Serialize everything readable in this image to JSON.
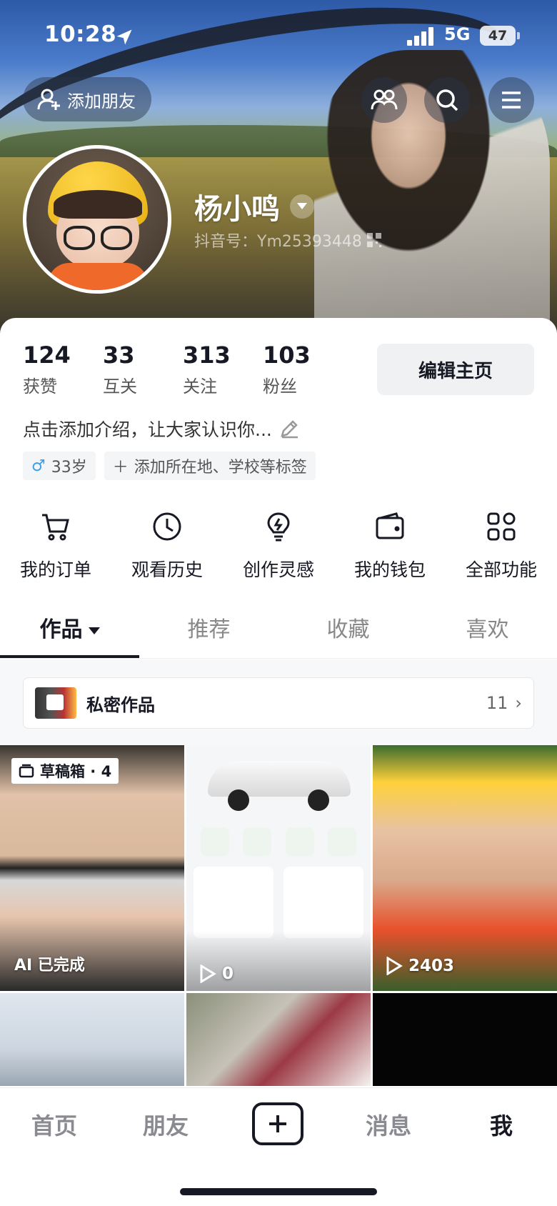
{
  "status_bar": {
    "time": "10:28",
    "network": "5G",
    "battery": "47"
  },
  "header": {
    "add_friend_label": "添加朋友",
    "username": "杨小鸣",
    "douyin_id": "抖音号：Ym25393448"
  },
  "stats": [
    {
      "value": "124",
      "label": "获赞"
    },
    {
      "value": "33",
      "label": "互关"
    },
    {
      "value": "313",
      "label": "关注"
    },
    {
      "value": "103",
      "label": "粉丝"
    }
  ],
  "edit_profile_label": "编辑主页",
  "bio": "点击添加介绍，让大家认识你...",
  "tags": {
    "age": "33岁",
    "add_tag": "添加所在地、学校等标签"
  },
  "features": [
    {
      "label": "我的订单",
      "icon": "cart-icon"
    },
    {
      "label": "观看历史",
      "icon": "clock-icon"
    },
    {
      "label": "创作灵感",
      "icon": "lightbulb-icon"
    },
    {
      "label": "我的钱包",
      "icon": "wallet-icon"
    },
    {
      "label": "全部功能",
      "icon": "grid-icon"
    }
  ],
  "tabs": [
    {
      "label": "作品",
      "active": true
    },
    {
      "label": "推荐"
    },
    {
      "label": "收藏"
    },
    {
      "label": "喜欢"
    }
  ],
  "private_works": {
    "label": "私密作品",
    "count": "11"
  },
  "videos": [
    {
      "badge": "草稿箱 · 4",
      "status": "AI 已完成"
    },
    {
      "plays": "0"
    },
    {
      "plays": "2403"
    }
  ],
  "bottom_nav": {
    "home": "首页",
    "friends": "朋友",
    "messages": "消息",
    "me": "我"
  }
}
